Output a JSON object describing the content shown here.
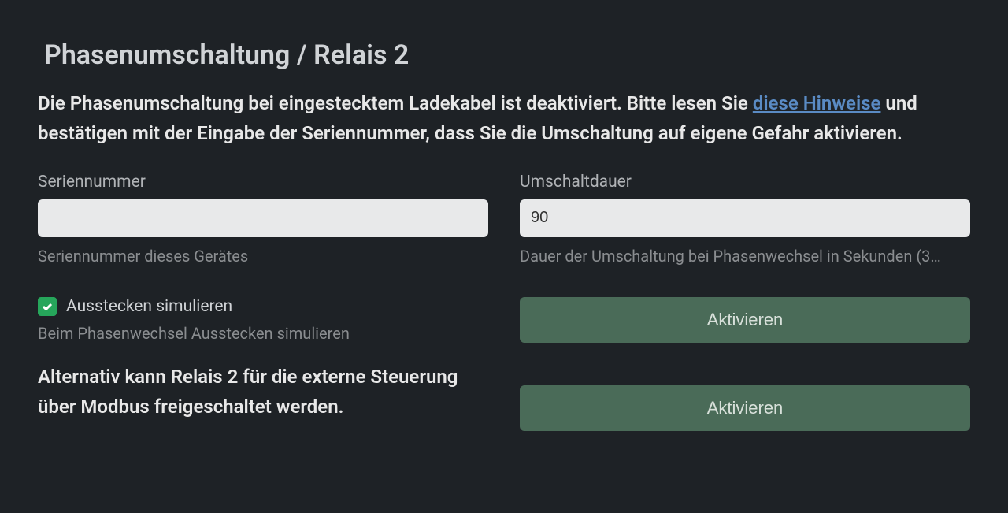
{
  "page": {
    "title": "Phasenumschaltung / Relais 2"
  },
  "description": {
    "text_before": "Die Phasenumschaltung bei eingestecktem Ladekabel ist deaktiviert. Bitte lesen Sie ",
    "link_text": "diese Hinweise",
    "text_after": " und bestätigen mit der Eingabe der Seriennummer, dass Sie die Umschaltung auf eigene Gefahr aktivieren."
  },
  "fields": {
    "serial": {
      "label": "Seriennummer",
      "value": "",
      "help": "Seriennummer dieses Gerätes"
    },
    "duration": {
      "label": "Umschaltdauer",
      "value": "90",
      "help": "Dauer der Umschaltung bei Phasenwechsel in Sekunden (3…"
    }
  },
  "checkbox": {
    "label": "Ausstecken simulieren",
    "help": "Beim Phasenwechsel Ausstecken simulieren",
    "checked": true
  },
  "alt_description": "Alternativ kann Relais 2 für die externe Steuerung über Modbus freigeschaltet werden.",
  "buttons": {
    "activate1": "Aktivieren",
    "activate2": "Aktivieren"
  }
}
